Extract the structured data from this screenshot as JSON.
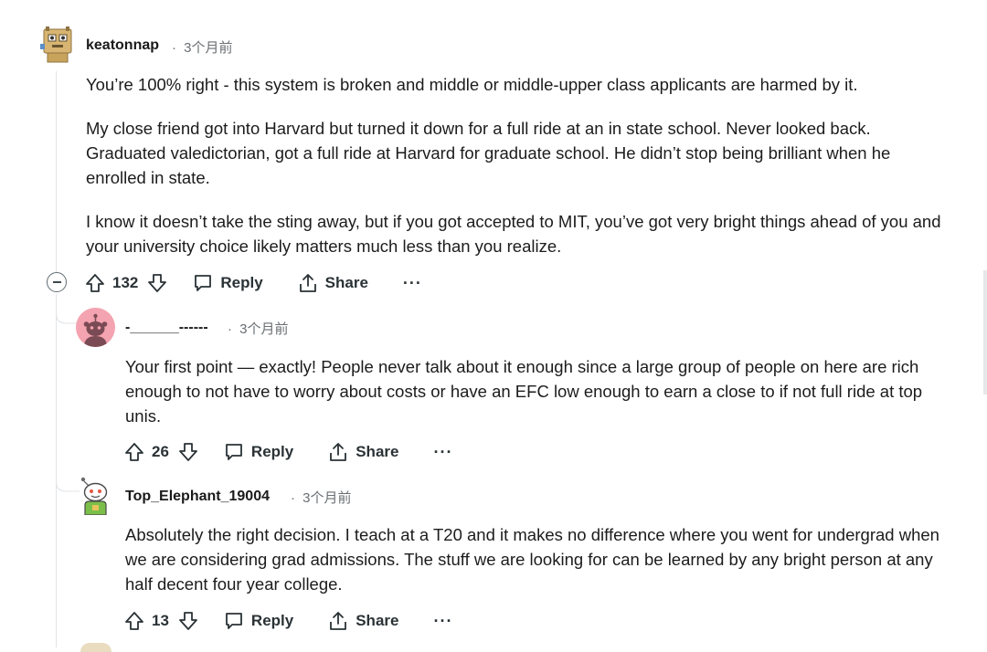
{
  "comments": [
    {
      "username": "keatonnap",
      "time": "3个月前",
      "avatar_icon": "robot-box-avatar-icon",
      "paragraphs": [
        "You’re 100% right - this system is broken and middle or middle-upper class applicants are harmed by it.",
        "My close friend got into Harvard but turned it down for a full ride at an in state school. Never looked back. Graduated valedictorian, got a full ride at Harvard for graduate school. He didn’t stop being brilliant when he enrolled in state.",
        "I know it doesn’t take the sting away, but if you got accepted to MIT, you’ve got very bright things ahead of you and your university choice likely matters much less than you realize."
      ],
      "votes": "132",
      "reply_label": "Reply",
      "share_label": "Share",
      "more_label": "···"
    },
    {
      "username": "-______------",
      "time": "3个月前",
      "avatar_icon": "default-snoo-avatar-icon",
      "paragraphs": [
        "Your first point — exactly! People never talk about it enough since a large group of people on here are rich enough to not have to worry about costs or have an EFC low enough to earn a close to if not full ride at top unis."
      ],
      "votes": "26",
      "reply_label": "Reply",
      "share_label": "Share",
      "more_label": "···"
    },
    {
      "username": "Top_Elephant_19004",
      "time": "3个月前",
      "avatar_icon": "snoo-character-avatar-icon",
      "paragraphs": [
        "Absolutely the right decision. I teach at a T20 and it makes no difference where you went for undergrad when we are considering grad admissions. The stuff we are looking for can be learned by any bright person at any half decent four year college."
      ],
      "votes": "13",
      "reply_label": "Reply",
      "share_label": "Share",
      "more_label": "···"
    }
  ],
  "colors": {
    "thread_line": "#e0e3e6",
    "meta_text": "#6a6f73",
    "avatar_pink": "#f4a3b0"
  },
  "icons": {
    "upvote": "upvote-arrow-icon",
    "downvote": "downvote-arrow-icon",
    "reply": "speech-bubble-icon",
    "share": "share-upload-icon",
    "collapse": "collapse-minus-icon"
  }
}
